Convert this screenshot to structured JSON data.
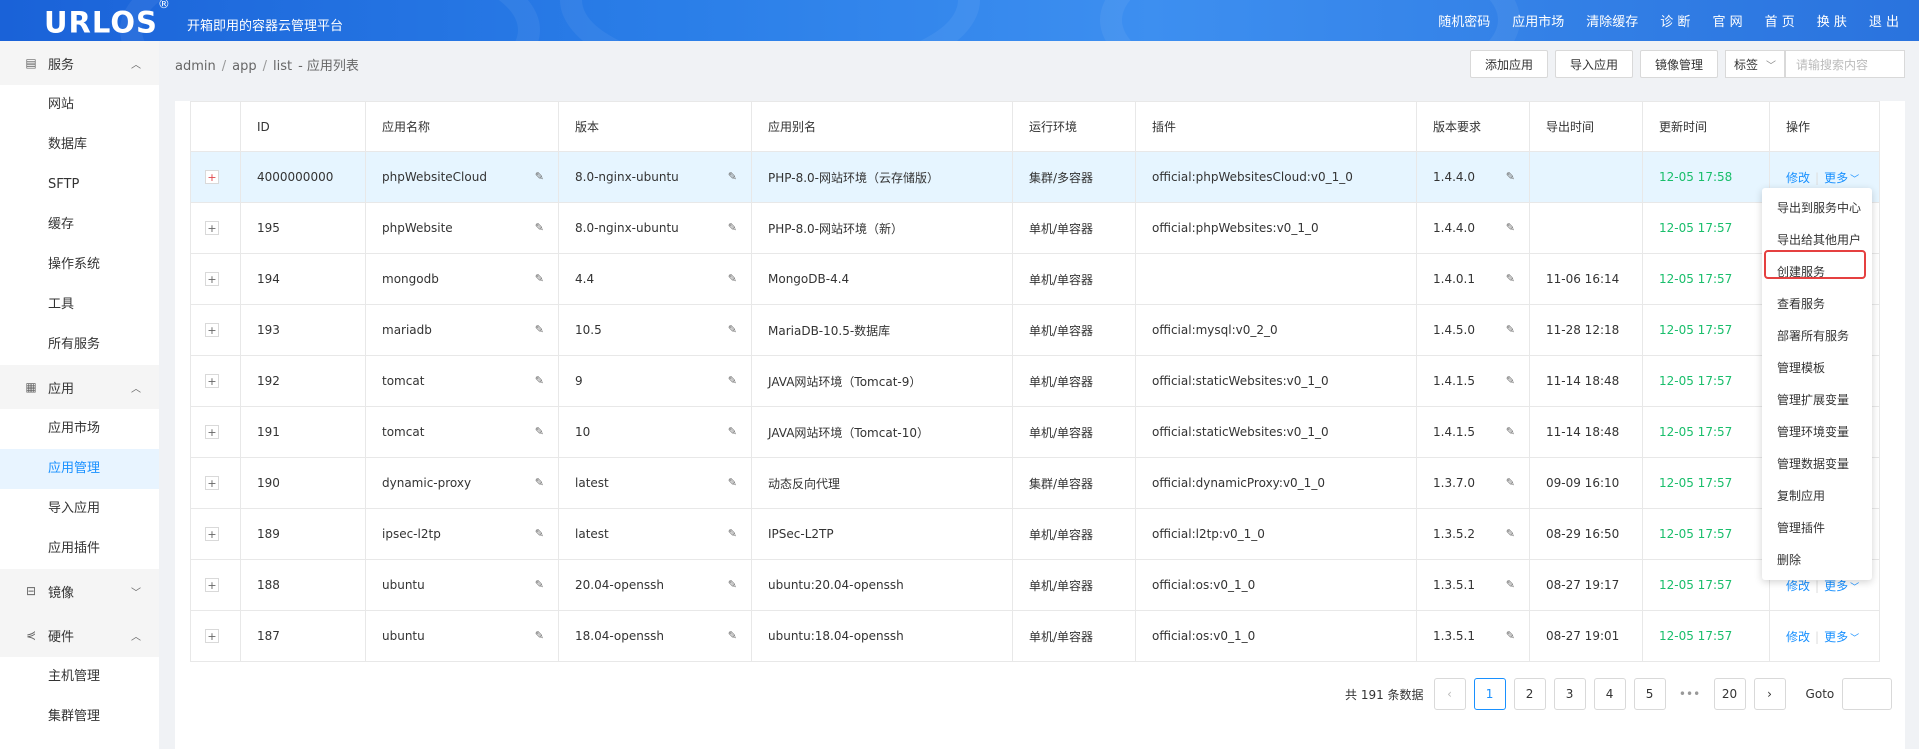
{
  "header": {
    "logo": "URLOS",
    "logo_mark": "®",
    "slogan": "开箱即用的容器云管理平台",
    "nav": [
      "随机密码",
      "应用市场",
      "清除缓存",
      "诊 断",
      "官 网",
      "首 页",
      "换 肤",
      "退 出"
    ]
  },
  "sidebar": {
    "groups": [
      {
        "label": "服务",
        "icon": "server-icon",
        "expanded": true,
        "items": [
          "网站",
          "数据库",
          "SFTP",
          "缓存",
          "操作系统",
          "工具",
          "所有服务"
        ]
      },
      {
        "label": "应用",
        "icon": "grid-icon",
        "expanded": true,
        "items": [
          "应用市场",
          "应用管理",
          "导入应用",
          "应用插件"
        ]
      },
      {
        "label": "镜像",
        "icon": "disk-icon",
        "expanded": false,
        "items": []
      },
      {
        "label": "硬件",
        "icon": "share-icon",
        "expanded": true,
        "items": [
          "主机管理",
          "集群管理"
        ]
      }
    ],
    "active_item": "应用管理"
  },
  "breadcrumb": [
    "admin",
    "app",
    "list"
  ],
  "breadcrumb_suffix": "- 应用列表",
  "toolbar": {
    "add_label": "添加应用",
    "import_label": "导入应用",
    "mirror_label": "镜像管理",
    "tag_label": "标签",
    "search_placeholder": "请输搜索内容"
  },
  "table": {
    "columns": [
      "ID",
      "应用名称",
      "版本",
      "应用别名",
      "运行环境",
      "插件",
      "版本要求",
      "导出时间",
      "更新时间",
      "操作"
    ],
    "rows": [
      {
        "id": "4000000000",
        "name": "phpWebsiteCloud",
        "version": "8.0-nginx-ubuntu",
        "alias": "PHP-8.0-网站环境（云存储版）",
        "env": "集群/多容器",
        "plugin": "official:phpWebsitesCloud:v0_1_0",
        "req": "1.4.4.0",
        "export": "",
        "update": "12-05 17:58"
      },
      {
        "id": "195",
        "name": "phpWebsite",
        "version": "8.0-nginx-ubuntu",
        "alias": "PHP-8.0-网站环境（新）",
        "env": "单机/单容器",
        "plugin": "official:phpWebsites:v0_1_0",
        "req": "1.4.4.0",
        "export": "",
        "update": "12-05 17:57"
      },
      {
        "id": "194",
        "name": "mongodb",
        "version": "4.4",
        "alias": "MongoDB-4.4",
        "env": "单机/单容器",
        "plugin": "",
        "req": "1.4.0.1",
        "export": "11-06 16:14",
        "update": "12-05 17:57"
      },
      {
        "id": "193",
        "name": "mariadb",
        "version": "10.5",
        "alias": "MariaDB-10.5-数据库",
        "env": "单机/单容器",
        "plugin": "official:mysql:v0_2_0",
        "req": "1.4.5.0",
        "export": "11-28 12:18",
        "update": "12-05 17:57"
      },
      {
        "id": "192",
        "name": "tomcat",
        "version": "9",
        "alias": "JAVA网站环境（Tomcat-9）",
        "env": "单机/单容器",
        "plugin": "official:staticWebsites:v0_1_0",
        "req": "1.4.1.5",
        "export": "11-14 18:48",
        "update": "12-05 17:57"
      },
      {
        "id": "191",
        "name": "tomcat",
        "version": "10",
        "alias": "JAVA网站环境（Tomcat-10）",
        "env": "单机/单容器",
        "plugin": "official:staticWebsites:v0_1_0",
        "req": "1.4.1.5",
        "export": "11-14 18:48",
        "update": "12-05 17:57"
      },
      {
        "id": "190",
        "name": "dynamic-proxy",
        "version": "latest",
        "alias": "动态反向代理",
        "env": "集群/单容器",
        "plugin": "official:dynamicProxy:v0_1_0",
        "req": "1.3.7.0",
        "export": "09-09 16:10",
        "update": "12-05 17:57"
      },
      {
        "id": "189",
        "name": "ipsec-l2tp",
        "version": "latest",
        "alias": "IPSec-L2TP",
        "env": "单机/单容器",
        "plugin": "official:l2tp:v0_1_0",
        "req": "1.3.5.2",
        "export": "08-29 16:50",
        "update": "12-05 17:57"
      },
      {
        "id": "188",
        "name": "ubuntu",
        "version": "20.04-openssh",
        "alias": "ubuntu:20.04-openssh",
        "env": "单机/单容器",
        "plugin": "official:os:v0_1_0",
        "req": "1.3.5.1",
        "export": "08-27 19:17",
        "update": "12-05 17:57"
      },
      {
        "id": "187",
        "name": "ubuntu",
        "version": "18.04-openssh",
        "alias": "ubuntu:18.04-openssh",
        "env": "单机/单容器",
        "plugin": "official:os:v0_1_0",
        "req": "1.3.5.1",
        "export": "08-27 19:01",
        "update": "12-05 17:57"
      }
    ],
    "ops_edit": "修改",
    "ops_more": "更多"
  },
  "dropdown": {
    "items": [
      "导出到服务中心",
      "导出给其他用户",
      "创建服务",
      "查看服务",
      "部署所有服务",
      "管理模板",
      "管理扩展变量",
      "管理环境变量",
      "管理数据变量",
      "复制应用",
      "管理插件",
      "删除"
    ],
    "highlighted": "创建服务"
  },
  "pagination": {
    "total_text": "共 191 条数据",
    "pages": [
      "1",
      "2",
      "3",
      "4",
      "5",
      "20"
    ],
    "current": "1",
    "goto_label": "Goto"
  },
  "colors": {
    "accent": "#1890ff",
    "time": "#19be6b",
    "highlight_border": "#e54040"
  }
}
